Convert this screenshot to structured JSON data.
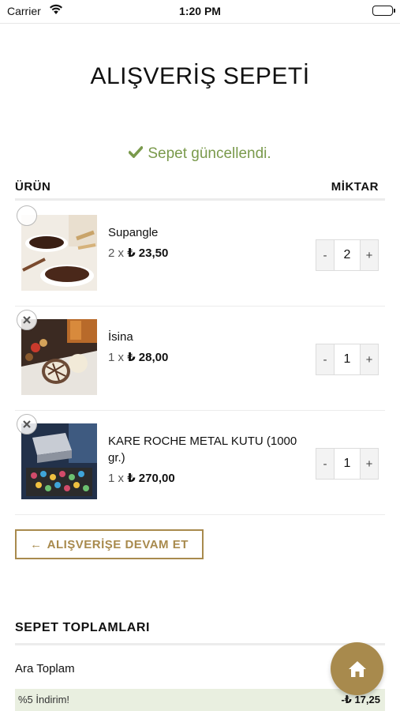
{
  "status_bar": {
    "carrier": "Carrier",
    "time": "1:20 PM"
  },
  "page_title": "ALIŞVERİŞ SEPETİ",
  "notice": {
    "icon": "check-icon",
    "text": "Sepet güncellendi.",
    "color": "#7a9a4c"
  },
  "table": {
    "product_header": "ÜRÜN",
    "quantity_header": "MİKTAR"
  },
  "items": [
    {
      "name": "Supangle",
      "qty_prefix": "2 x",
      "price": "₺ 23,50",
      "quantity": "2",
      "remove_icon": "circle-icon"
    },
    {
      "name": "İsina",
      "qty_prefix": "1 x",
      "price": "₺ 28,00",
      "quantity": "1",
      "remove_icon": "close-icon"
    },
    {
      "name": "KARE ROCHE METAL KUTU (1000 gr.)",
      "qty_prefix": "1 x",
      "price": "₺ 270,00",
      "quantity": "1",
      "remove_icon": "close-icon"
    }
  ],
  "stepper": {
    "minus": "-",
    "plus": "+"
  },
  "continue_button": {
    "arrow": "←",
    "label": "ALIŞVERİŞE DEVAM ET",
    "color": "#a88a4d"
  },
  "totals": {
    "title": "SEPET TOPLAMLARI",
    "subtotal_label": "Ara Toplam",
    "discount_label": "%5 İndirim!",
    "discount_amount": "-₺ 17,25"
  },
  "fab": {
    "icon": "home-icon",
    "color": "#a88a4d"
  }
}
